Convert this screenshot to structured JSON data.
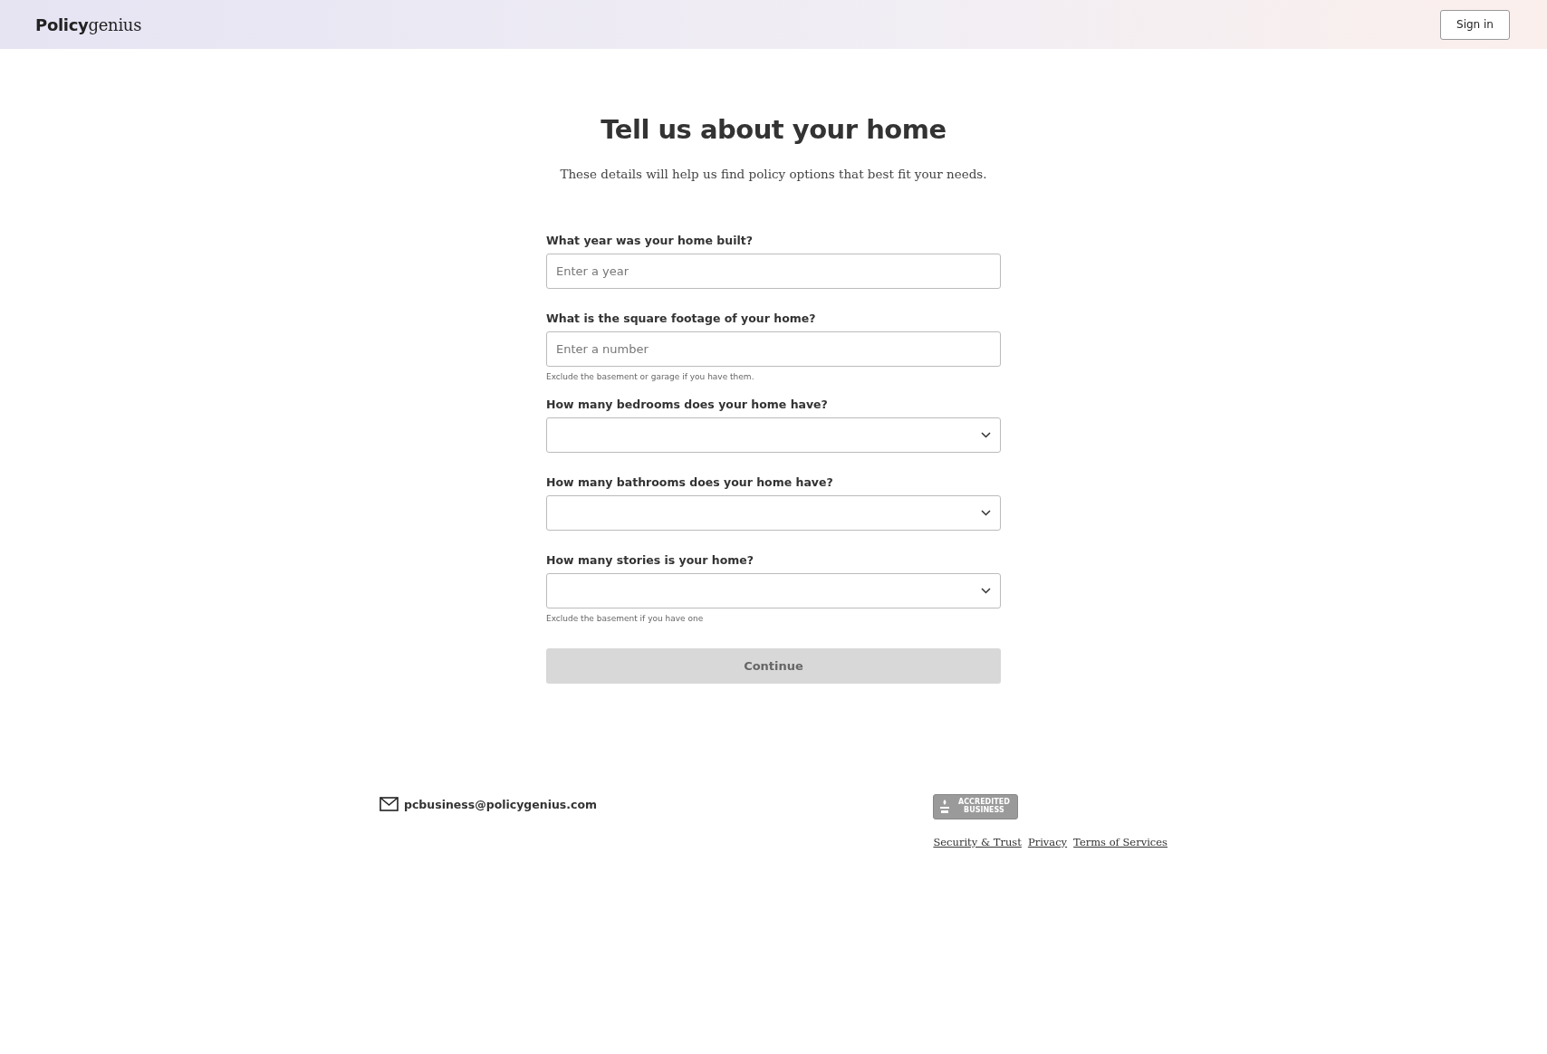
{
  "header": {
    "logo": "**Policy**genius",
    "sign_in": "Sign in"
  },
  "title": "Tell us about your home",
  "subtitle": "These details will help us find policy options that best fit your needs.",
  "fields": [
    {
      "kind": "text",
      "label": "What year was your home built?",
      "placeholder": "Enter a year"
    },
    {
      "kind": "text",
      "label": "What is the square footage of your home?",
      "placeholder": "Enter a number",
      "hint": "Exclude the basement or garage if you have them."
    },
    {
      "kind": "select",
      "label": "How many bedrooms does your home have?"
    },
    {
      "kind": "select",
      "label": "How many bathrooms does your home have?"
    },
    {
      "kind": "select",
      "label": "How many stories is your home?",
      "hint": "Exclude the basement if you have one"
    }
  ],
  "continue_button": {
    "label": "Continue",
    "disabled": true
  },
  "footer": {
    "email": "pcbusiness@policygenius.com",
    "badge": "ACCREDITED BUSINESS",
    "links": [
      "Security & Trust",
      "Privacy",
      "Terms of Services"
    ]
  }
}
